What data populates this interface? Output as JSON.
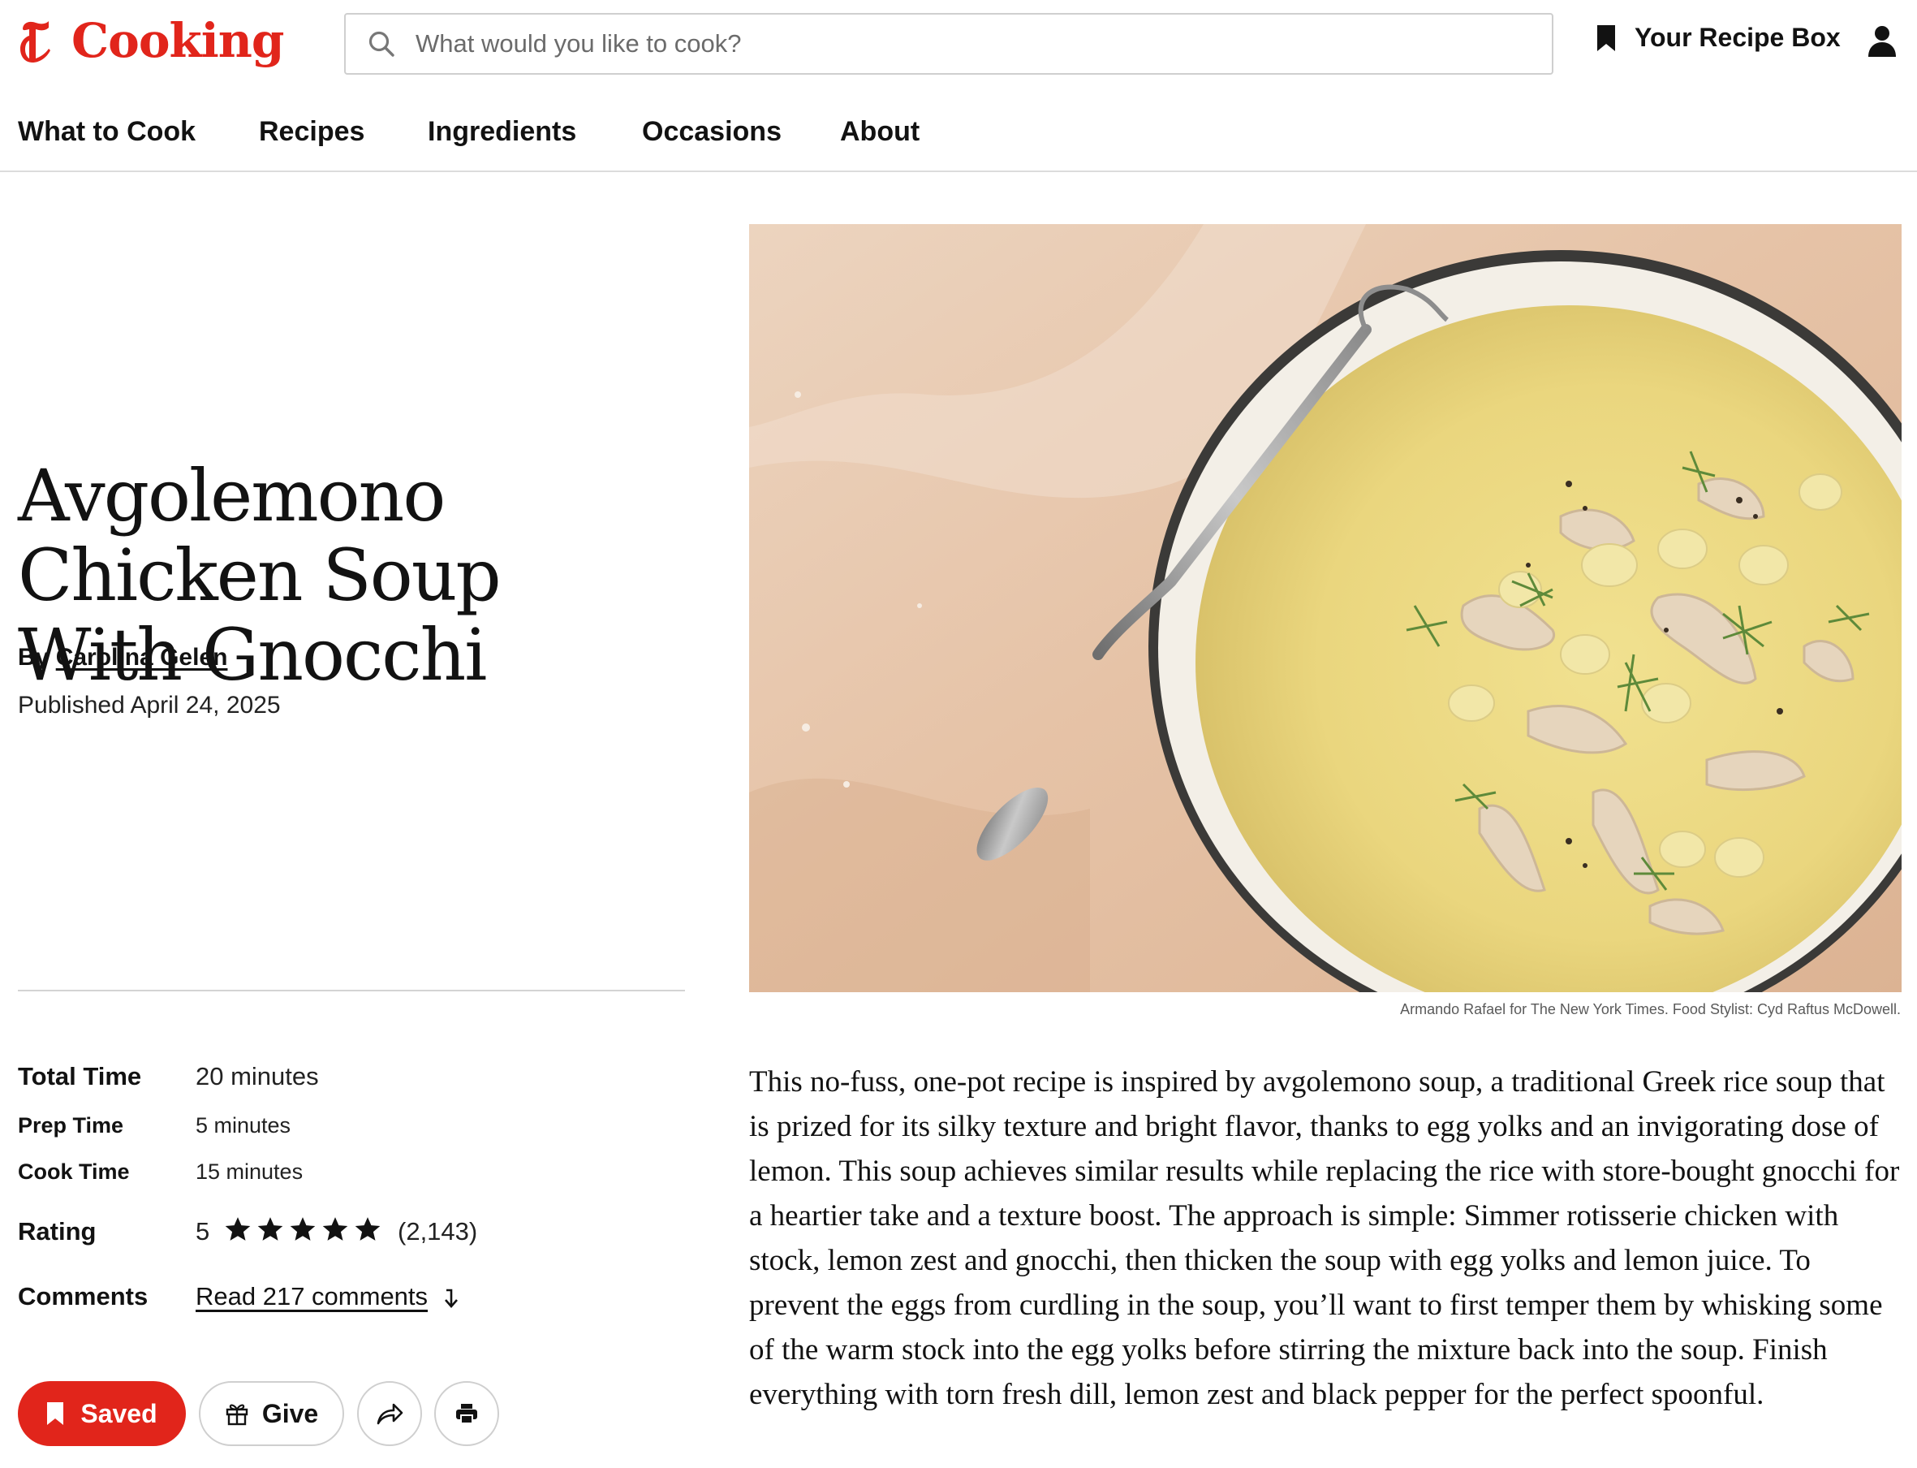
{
  "header": {
    "logo_text": "Cooking",
    "search_placeholder": "What would you like to cook?",
    "recipe_box_label": "Your Recipe Box"
  },
  "nav": {
    "items": [
      "What to Cook",
      "Recipes",
      "Ingredients",
      "Occasions",
      "About"
    ]
  },
  "recipe": {
    "title": "Avgolemono Chicken Soup With Gnocchi",
    "byline_prefix": "By",
    "author": "Carolina Gelen",
    "published": "Published April 24, 2025",
    "meta": {
      "total_time_label": "Total Time",
      "total_time": "20 minutes",
      "prep_time_label": "Prep Time",
      "prep_time": "5 minutes",
      "cook_time_label": "Cook Time",
      "cook_time": "15 minutes",
      "rating_label": "Rating",
      "rating_value": "5",
      "rating_stars": 5,
      "rating_count": "(2,143)",
      "comments_label": "Comments",
      "comments_link": "Read 217 comments"
    },
    "actions": {
      "saved_label": "Saved",
      "give_label": "Give"
    },
    "photo_credit": "Armando Rafael for The New York Times. Food Stylist: Cyd Raftus McDowell.",
    "description": "This no-fuss, one-pot recipe is inspired by avgolemono soup, a traditional Greek rice soup that is prized for its silky texture and bright flavor, thanks to egg yolks and an invigorating dose of lemon. This soup achieves similar results while replacing the rice with store-bought gnocchi for a heartier take and a texture boost. The approach is simple: Simmer rotisserie chicken with stock, lemon zest and gnocchi, then thicken the soup with egg yolks and lemon juice. To prevent the eggs from curdling in the soup, you’ll want to first temper them by whisking some of the warm stock into the egg yolks before stirring the mixture back into the soup. Finish everything with torn fresh dill, lemon zest and black pepper for the perfect spoonful."
  },
  "colors": {
    "brand_red": "#e1251b",
    "text": "#121212",
    "border": "#cfcfcf"
  },
  "icons": [
    "nyt-t-logo-icon",
    "search-icon",
    "bookmark-icon",
    "user-icon",
    "star-icon",
    "arrow-down-icon",
    "gift-icon",
    "share-icon",
    "print-icon"
  ]
}
